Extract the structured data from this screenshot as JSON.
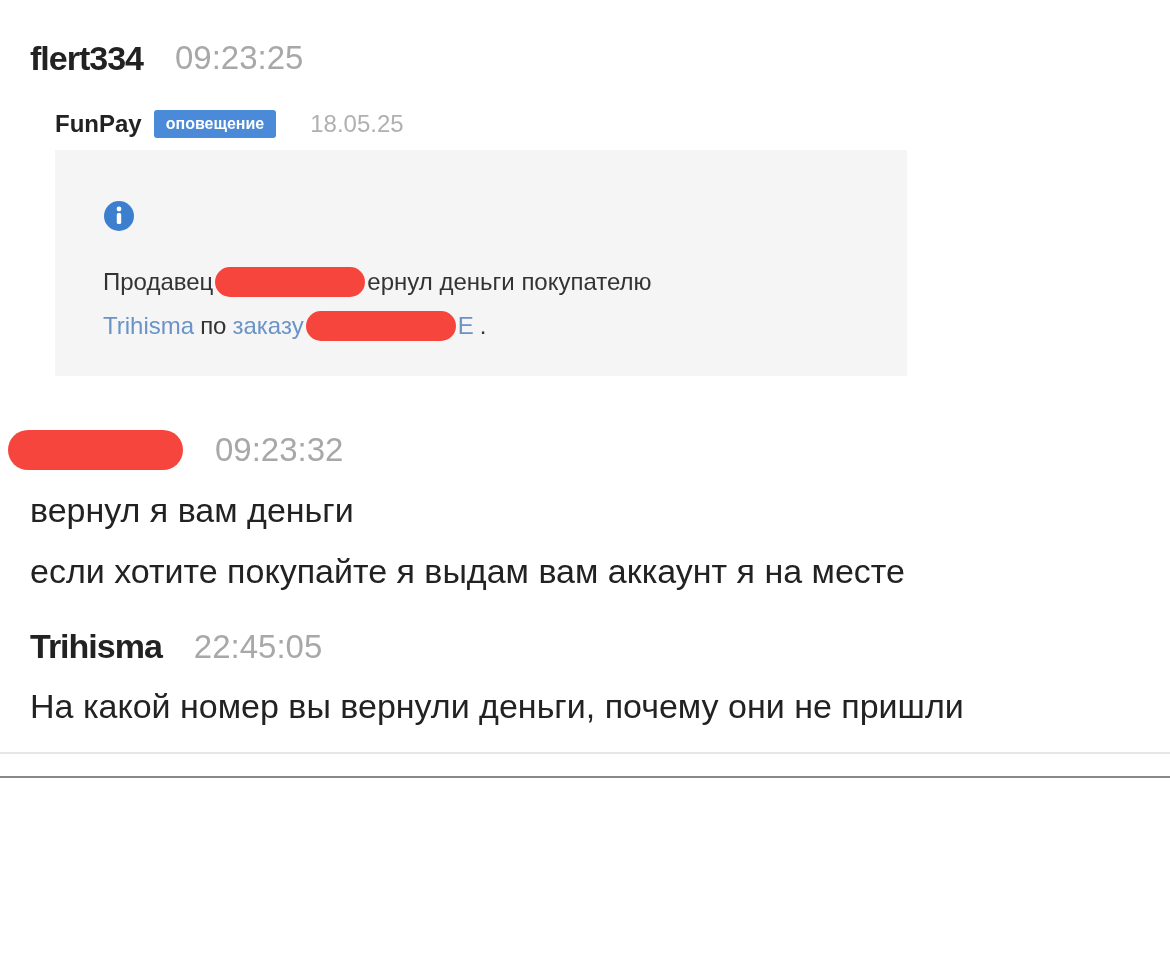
{
  "messages": [
    {
      "author": {
        "kind": "text",
        "text": "flert334"
      },
      "time": "09:23:25",
      "notice": {
        "sender": "FunPay",
        "badge": "оповещение",
        "date": "18.05.25",
        "lines": [
          [
            {
              "kind": "text",
              "text": "Продавец"
            },
            {
              "kind": "redaction"
            },
            {
              "kind": "text",
              "text": "ернул деньги покупателю"
            }
          ],
          [
            {
              "kind": "link",
              "text": "Trihisma"
            },
            {
              "kind": "text",
              "text": "по"
            },
            {
              "kind": "link",
              "text": "заказу"
            },
            {
              "kind": "redaction"
            },
            {
              "kind": "link",
              "text": "E"
            },
            {
              "kind": "text",
              "text": "."
            }
          ]
        ]
      }
    },
    {
      "author": {
        "kind": "redaction"
      },
      "time": "09:23:32",
      "texts": [
        "вернул я вам деньги",
        "если хотите покупайте я выдам вам аккаунт я на месте"
      ]
    },
    {
      "author": {
        "kind": "text",
        "text": "Trihisma"
      },
      "time": "22:45:05",
      "texts": [
        "На какой номер вы вернули деньги, почему они не пришли"
      ]
    }
  ]
}
